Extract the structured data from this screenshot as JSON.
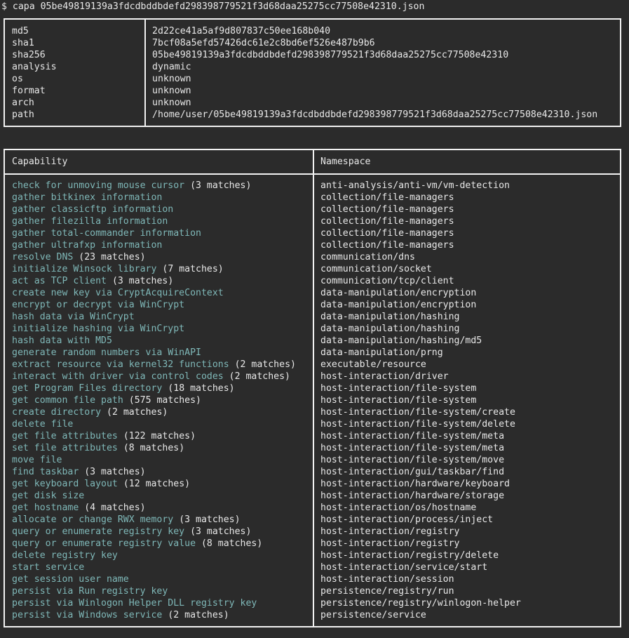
{
  "terminal": {
    "prompt": "$",
    "command": "capa 05be49819139a3fdcdbddbdefd298398779521f3d68daa25275cc77508e42310.json"
  },
  "colors": {
    "background": "#2b2b2b",
    "border": "#f2f2f2",
    "capability_name": "#7fb8b8",
    "text": "#e8e8e8"
  },
  "metadata": [
    {
      "key": "md5",
      "value": "2d22ce41a5af9d807837c50ee168b040"
    },
    {
      "key": "sha1",
      "value": "7bcf08a5efd57426dc61e2c8bd6ef526e487b9b6"
    },
    {
      "key": "sha256",
      "value": "05be49819139a3fdcdbddbdefd298398779521f3d68daa25275cc77508e42310"
    },
    {
      "key": "analysis",
      "value": "dynamic"
    },
    {
      "key": "os",
      "value": "unknown"
    },
    {
      "key": "format",
      "value": "unknown"
    },
    {
      "key": "arch",
      "value": "unknown"
    },
    {
      "key": "path",
      "value": "/home/user/05be49819139a3fdcdbddbdefd298398779521f3d68daa25275cc77508e42310.json"
    }
  ],
  "capabilities_table": {
    "headers": {
      "capability": "Capability",
      "namespace": "Namespace"
    },
    "rows": [
      {
        "name": "check for unmoving mouse cursor",
        "matches": "(3 matches)",
        "namespace": "anti-analysis/anti-vm/vm-detection"
      },
      {
        "name": "gather bitkinex information",
        "matches": "",
        "namespace": "collection/file-managers"
      },
      {
        "name": "gather classicftp information",
        "matches": "",
        "namespace": "collection/file-managers"
      },
      {
        "name": "gather filezilla information",
        "matches": "",
        "namespace": "collection/file-managers"
      },
      {
        "name": "gather total-commander information",
        "matches": "",
        "namespace": "collection/file-managers"
      },
      {
        "name": "gather ultrafxp information",
        "matches": "",
        "namespace": "collection/file-managers"
      },
      {
        "name": "resolve DNS",
        "matches": "(23 matches)",
        "namespace": "communication/dns"
      },
      {
        "name": "initialize Winsock library",
        "matches": "(7 matches)",
        "namespace": "communication/socket"
      },
      {
        "name": "act as TCP client",
        "matches": "(3 matches)",
        "namespace": "communication/tcp/client"
      },
      {
        "name": "create new key via CryptAcquireContext",
        "matches": "",
        "namespace": "data-manipulation/encryption"
      },
      {
        "name": "encrypt or decrypt via WinCrypt",
        "matches": "",
        "namespace": "data-manipulation/encryption"
      },
      {
        "name": "hash data via WinCrypt",
        "matches": "",
        "namespace": "data-manipulation/hashing"
      },
      {
        "name": "initialize hashing via WinCrypt",
        "matches": "",
        "namespace": "data-manipulation/hashing"
      },
      {
        "name": "hash data with MD5",
        "matches": "",
        "namespace": "data-manipulation/hashing/md5"
      },
      {
        "name": "generate random numbers via WinAPI",
        "matches": "",
        "namespace": "data-manipulation/prng"
      },
      {
        "name": "extract resource via kernel32 functions",
        "matches": "(2 matches)",
        "namespace": "executable/resource"
      },
      {
        "name": "interact with driver via control codes",
        "matches": "(2 matches)",
        "namespace": "host-interaction/driver"
      },
      {
        "name": "get Program Files directory",
        "matches": "(18 matches)",
        "namespace": "host-interaction/file-system"
      },
      {
        "name": "get common file path",
        "matches": "(575 matches)",
        "namespace": "host-interaction/file-system"
      },
      {
        "name": "create directory",
        "matches": "(2 matches)",
        "namespace": "host-interaction/file-system/create"
      },
      {
        "name": "delete file",
        "matches": "",
        "namespace": "host-interaction/file-system/delete"
      },
      {
        "name": "get file attributes",
        "matches": "(122 matches)",
        "namespace": "host-interaction/file-system/meta"
      },
      {
        "name": "set file attributes",
        "matches": "(8 matches)",
        "namespace": "host-interaction/file-system/meta"
      },
      {
        "name": "move file",
        "matches": "",
        "namespace": "host-interaction/file-system/move"
      },
      {
        "name": "find taskbar",
        "matches": "(3 matches)",
        "namespace": "host-interaction/gui/taskbar/find"
      },
      {
        "name": "get keyboard layout",
        "matches": "(12 matches)",
        "namespace": "host-interaction/hardware/keyboard"
      },
      {
        "name": "get disk size",
        "matches": "",
        "namespace": "host-interaction/hardware/storage"
      },
      {
        "name": "get hostname",
        "matches": "(4 matches)",
        "namespace": "host-interaction/os/hostname"
      },
      {
        "name": "allocate or change RWX memory",
        "matches": "(3 matches)",
        "namespace": "host-interaction/process/inject"
      },
      {
        "name": "query or enumerate registry key",
        "matches": "(3 matches)",
        "namespace": "host-interaction/registry"
      },
      {
        "name": "query or enumerate registry value",
        "matches": "(8 matches)",
        "namespace": "host-interaction/registry"
      },
      {
        "name": "delete registry key",
        "matches": "",
        "namespace": "host-interaction/registry/delete"
      },
      {
        "name": "start service",
        "matches": "",
        "namespace": "host-interaction/service/start"
      },
      {
        "name": "get session user name",
        "matches": "",
        "namespace": "host-interaction/session"
      },
      {
        "name": "persist via Run registry key",
        "matches": "",
        "namespace": "persistence/registry/run"
      },
      {
        "name": "persist via Winlogon Helper DLL registry key",
        "matches": "",
        "namespace": "persistence/registry/winlogon-helper"
      },
      {
        "name": "persist via Windows service",
        "matches": "(2 matches)",
        "namespace": "persistence/service"
      }
    ]
  }
}
